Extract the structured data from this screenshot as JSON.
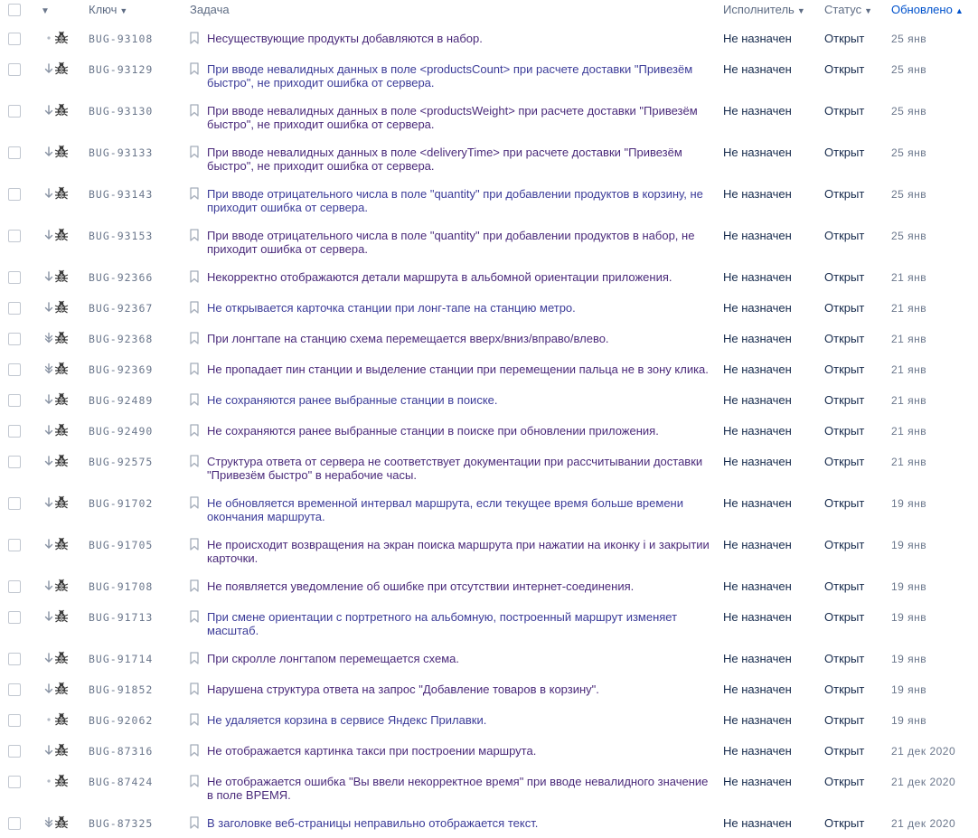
{
  "columns": {
    "key": "Ключ",
    "summary": "Задача",
    "assignee": "Исполнитель",
    "status": "Статус",
    "updated": "Обновлено"
  },
  "sort": {
    "down": "▼",
    "up": "▲"
  },
  "colors": {
    "link": "#3b3b98",
    "visited": "#4a2a7a",
    "muted": "#6b778c",
    "accent": "#0052cc"
  },
  "rows": [
    {
      "priority": "dot",
      "key": "BUG-93108",
      "summary": "Несуществующие продукты добавляются в набор.",
      "assignee": "Не назначен",
      "status": "Открыт",
      "updated": "25 янв"
    },
    {
      "priority": "arrow-down",
      "key": "BUG-93129",
      "summary": "При вводе невалидных данных в поле <productsCount> при расчете доставки \"Привезём быстро\", не приходит ошибка от сервера.",
      "assignee": "Не назначен",
      "status": "Открыт",
      "updated": "25 янв"
    },
    {
      "priority": "arrow-down",
      "key": "BUG-93130",
      "summary": "При вводе невалидных данных в поле <productsWeight> при расчете доставки \"Привезём быстро\", не приходит ошибка от сервера.",
      "assignee": "Не назначен",
      "status": "Открыт",
      "updated": "25 янв"
    },
    {
      "priority": "arrow-down",
      "key": "BUG-93133",
      "summary": "При вводе невалидных данных в поле <deliveryTime> при расчете доставки \"Привезём быстро\", не приходит ошибка от сервера.",
      "assignee": "Не назначен",
      "status": "Открыт",
      "updated": "25 янв"
    },
    {
      "priority": "arrow-down",
      "key": "BUG-93143",
      "summary": "При вводе отрицательного числа в поле \"quantity\" при добавлении продуктов в корзину, не приходит ошибка от сервера.",
      "assignee": "Не назначен",
      "status": "Открыт",
      "updated": "25 янв"
    },
    {
      "priority": "arrow-down",
      "key": "BUG-93153",
      "summary": "При вводе отрицательного числа в поле \"quantity\" при добавлении продуктов в набор, не приходит ошибка от сервера.",
      "assignee": "Не назначен",
      "status": "Открыт",
      "updated": "25 янв"
    },
    {
      "priority": "arrow-down",
      "key": "BUG-92366",
      "summary": "Некорректно отображаются детали маршрута в альбомной ориентации приложения.",
      "assignee": "Не назначен",
      "status": "Открыт",
      "updated": "21 янв"
    },
    {
      "priority": "arrow-down",
      "key": "BUG-92367",
      "summary": "Не открывается карточка станции при лонг-тапе на станцию метро.",
      "assignee": "Не назначен",
      "status": "Открыт",
      "updated": "21 янв"
    },
    {
      "priority": "double-down",
      "key": "BUG-92368",
      "summary": "При лонгтапе на станцию схема перемещается вверх/вниз/вправо/влево.",
      "assignee": "Не назначен",
      "status": "Открыт",
      "updated": "21 янв"
    },
    {
      "priority": "double-down",
      "key": "BUG-92369",
      "summary": "Не пропадает пин станции и выделение станции при перемещении пальца не в зону клика.",
      "assignee": "Не назначен",
      "status": "Открыт",
      "updated": "21 янв"
    },
    {
      "priority": "arrow-down",
      "key": "BUG-92489",
      "summary": "Не сохраняются ранее выбранные станции в поиске.",
      "assignee": "Не назначен",
      "status": "Открыт",
      "updated": "21 янв"
    },
    {
      "priority": "arrow-down",
      "key": "BUG-92490",
      "summary": "Не сохраняются ранее выбранные станции в поиске при обновлении приложения.",
      "assignee": "Не назначен",
      "status": "Открыт",
      "updated": "21 янв"
    },
    {
      "priority": "arrow-down",
      "key": "BUG-92575",
      "summary": "Структура ответа от сервера не соответствует документации при рассчитывании доставки \"Привезём быстро\" в нерабочие часы.",
      "assignee": "Не назначен",
      "status": "Открыт",
      "updated": "21 янв"
    },
    {
      "priority": "arrow-down",
      "key": "BUG-91702",
      "summary": "Не обновляется временной интервал маршрута, если текущее время больше времени окончания маршрута.",
      "assignee": "Не назначен",
      "status": "Открыт",
      "updated": "19 янв"
    },
    {
      "priority": "arrow-down",
      "key": "BUG-91705",
      "summary": "Не происходит возвращения на экран поиска маршрута при нажатии на иконку i и закрытии карточки.",
      "assignee": "Не назначен",
      "status": "Открыт",
      "updated": "19 янв"
    },
    {
      "priority": "arrow-down",
      "key": "BUG-91708",
      "summary": "Не появляется уведомление об ошибке при отсутствии интернет-соединения.",
      "assignee": "Не назначен",
      "status": "Открыт",
      "updated": "19 янв"
    },
    {
      "priority": "arrow-down",
      "key": "BUG-91713",
      "summary": "При смене ориентации с портретного на альбомную, построенный маршрут изменяет масштаб.",
      "assignee": "Не назначен",
      "status": "Открыт",
      "updated": "19 янв"
    },
    {
      "priority": "arrow-down",
      "key": "BUG-91714",
      "summary": "При скролле лонгтапом перемещается схема.",
      "assignee": "Не назначен",
      "status": "Открыт",
      "updated": "19 янв"
    },
    {
      "priority": "arrow-down",
      "key": "BUG-91852",
      "summary": "Нарушена структура ответа на запрос \"Добавление товаров в корзину\".",
      "assignee": "Не назначен",
      "status": "Открыт",
      "updated": "19 янв"
    },
    {
      "priority": "dot",
      "key": "BUG-92062",
      "summary": "Не удаляется корзина в сервисе Яндекс Прилавки.",
      "assignee": "Не назначен",
      "status": "Открыт",
      "updated": "19 янв"
    },
    {
      "priority": "arrow-down",
      "key": "BUG-87316",
      "summary": "Не отображается картинка такси при построении маршрута.",
      "assignee": "Не назначен",
      "status": "Открыт",
      "updated": "21 дек 2020"
    },
    {
      "priority": "dot",
      "key": "BUG-87424",
      "summary": "Не отображается ошибка \"Вы ввели некорректное время\" при вводе невалидного значение в поле ВРЕМЯ.",
      "assignee": "Не назначен",
      "status": "Открыт",
      "updated": "21 дек 2020"
    },
    {
      "priority": "double-down",
      "key": "BUG-87325",
      "summary": "В заголовке веб-страницы неправильно отображается текст.",
      "assignee": "Не назначен",
      "status": "Открыт",
      "updated": "21 дек 2020"
    }
  ]
}
